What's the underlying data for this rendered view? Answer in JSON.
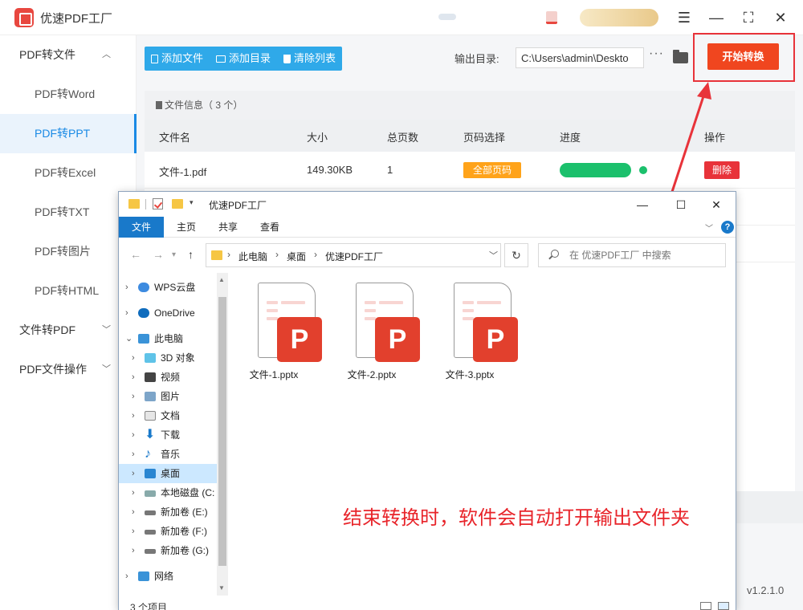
{
  "app": {
    "title": "优速PDF工厂",
    "version": "v1.2.1.0",
    "window_controls": [
      "menu-icon",
      "minimize-icon",
      "maximize-icon",
      "close-icon"
    ]
  },
  "sidebar": {
    "groups": [
      {
        "label": "PDF转文件",
        "expanded": true,
        "items": [
          "PDF转Word",
          "PDF转PPT",
          "PDF转Excel",
          "PDF转TXT",
          "PDF转图片",
          "PDF转HTML"
        ]
      },
      {
        "label": "文件转PDF",
        "expanded": false
      },
      {
        "label": "PDF文件操作",
        "expanded": false
      }
    ],
    "active_item": "PDF转PPT"
  },
  "toolbar": {
    "add_file": "添加文件",
    "add_folder": "添加目录",
    "clear_list": "清除列表",
    "output_label": "输出目录:",
    "output_path": "C:\\Users\\admin\\Deskto",
    "start_button": "开始转换"
  },
  "file_panel": {
    "info_label": "文件信息（ 3 个）",
    "columns": [
      "文件名",
      "大小",
      "总页数",
      "页码选择",
      "进度",
      "操作"
    ],
    "rows": [
      {
        "name": "文件-1.pdf",
        "size": "149.30KB",
        "pages": "1",
        "page_select": "全部页码",
        "progress": 1.0,
        "action": "删除"
      }
    ]
  },
  "explorer": {
    "title": "优速PDF工厂",
    "ribbon_tabs": [
      "文件",
      "主页",
      "共享",
      "查看"
    ],
    "breadcrumb": [
      "此电脑",
      "桌面",
      "优速PDF工厂"
    ],
    "search_placeholder": "在 优速PDF工厂 中搜索",
    "tree": [
      {
        "label": "WPS云盘",
        "icon": "cloud-icon",
        "level": 0
      },
      {
        "label": "OneDrive",
        "icon": "onedrive-icon",
        "level": 0
      },
      {
        "label": "此电脑",
        "icon": "computer-icon",
        "level": 0,
        "expanded": true
      },
      {
        "label": "3D 对象",
        "icon": "cube-icon",
        "level": 1
      },
      {
        "label": "视频",
        "icon": "video-icon",
        "level": 1
      },
      {
        "label": "图片",
        "icon": "picture-icon",
        "level": 1
      },
      {
        "label": "文档",
        "icon": "document-icon",
        "level": 1
      },
      {
        "label": "下载",
        "icon": "download-icon",
        "level": 1
      },
      {
        "label": "音乐",
        "icon": "music-icon",
        "level": 1
      },
      {
        "label": "桌面",
        "icon": "desktop-icon",
        "level": 1,
        "selected": true
      },
      {
        "label": "本地磁盘 (C:",
        "icon": "drive-icon",
        "level": 1
      },
      {
        "label": "新加卷 (E:)",
        "icon": "drive-icon",
        "level": 1
      },
      {
        "label": "新加卷 (F:)",
        "icon": "drive-icon",
        "level": 1
      },
      {
        "label": "新加卷 (G:)",
        "icon": "drive-icon",
        "level": 1
      },
      {
        "label": "网络",
        "icon": "network-icon",
        "level": 0
      }
    ],
    "files": [
      "文件-1.pptx",
      "文件-2.pptx",
      "文件-3.pptx"
    ],
    "ppt_badge_letter": "P",
    "status": "3 个项目"
  },
  "annotation": "结束转换时，软件会自动打开输出文件夹",
  "colors": {
    "accent_blue": "#2fa9e9",
    "start_orange": "#f0461f",
    "highlight_red": "#e8333a",
    "progress_green": "#1bc06c",
    "badge_orange": "#ffa31a",
    "ppt_red": "#e2402d"
  }
}
